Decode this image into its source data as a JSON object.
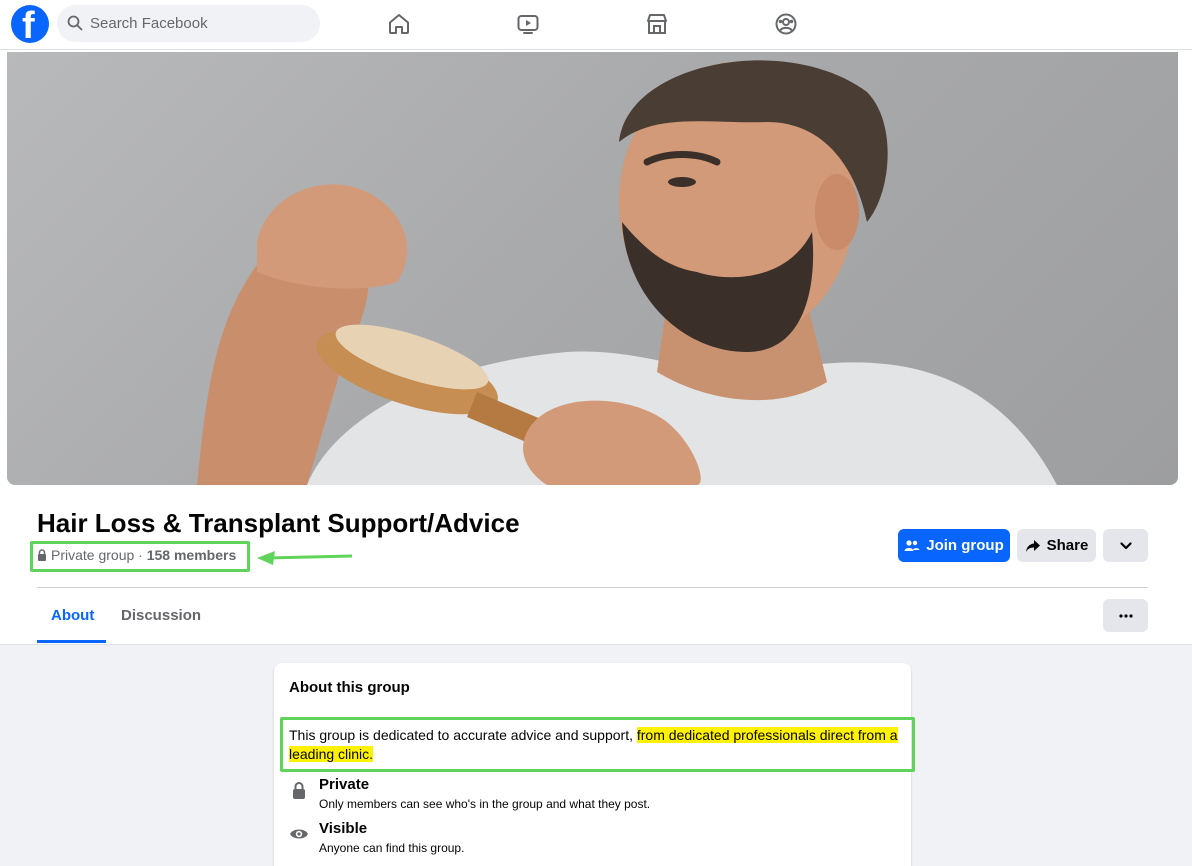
{
  "search": {
    "placeholder": "Search Facebook"
  },
  "nav": {
    "icons": [
      "home-icon",
      "video-icon",
      "marketplace-icon",
      "groups-icon"
    ]
  },
  "group": {
    "title": "Hair Loss & Transplant Support/Advice",
    "privacy": "Private group",
    "separator": " · ",
    "members": "158 members"
  },
  "actions": {
    "join": "Join group",
    "share": "Share"
  },
  "tabs": [
    {
      "label": "About",
      "active": true
    },
    {
      "label": "Discussion",
      "active": false
    }
  ],
  "about": {
    "title": "About this group",
    "description_plain": "This group is dedicated to accurate advice and support,",
    "description_highlight": "from dedicated professionals direct from a leading clinic.",
    "items": [
      {
        "icon": "lock-icon",
        "title": "Private",
        "subtitle": "Only members can see who's in the group and what they post."
      },
      {
        "icon": "eye-icon",
        "title": "Visible",
        "subtitle": "Anyone can find this group."
      }
    ]
  },
  "colors": {
    "brand": "#0866ff",
    "highlight": "#fff200",
    "annotation": "#5fd35a"
  }
}
